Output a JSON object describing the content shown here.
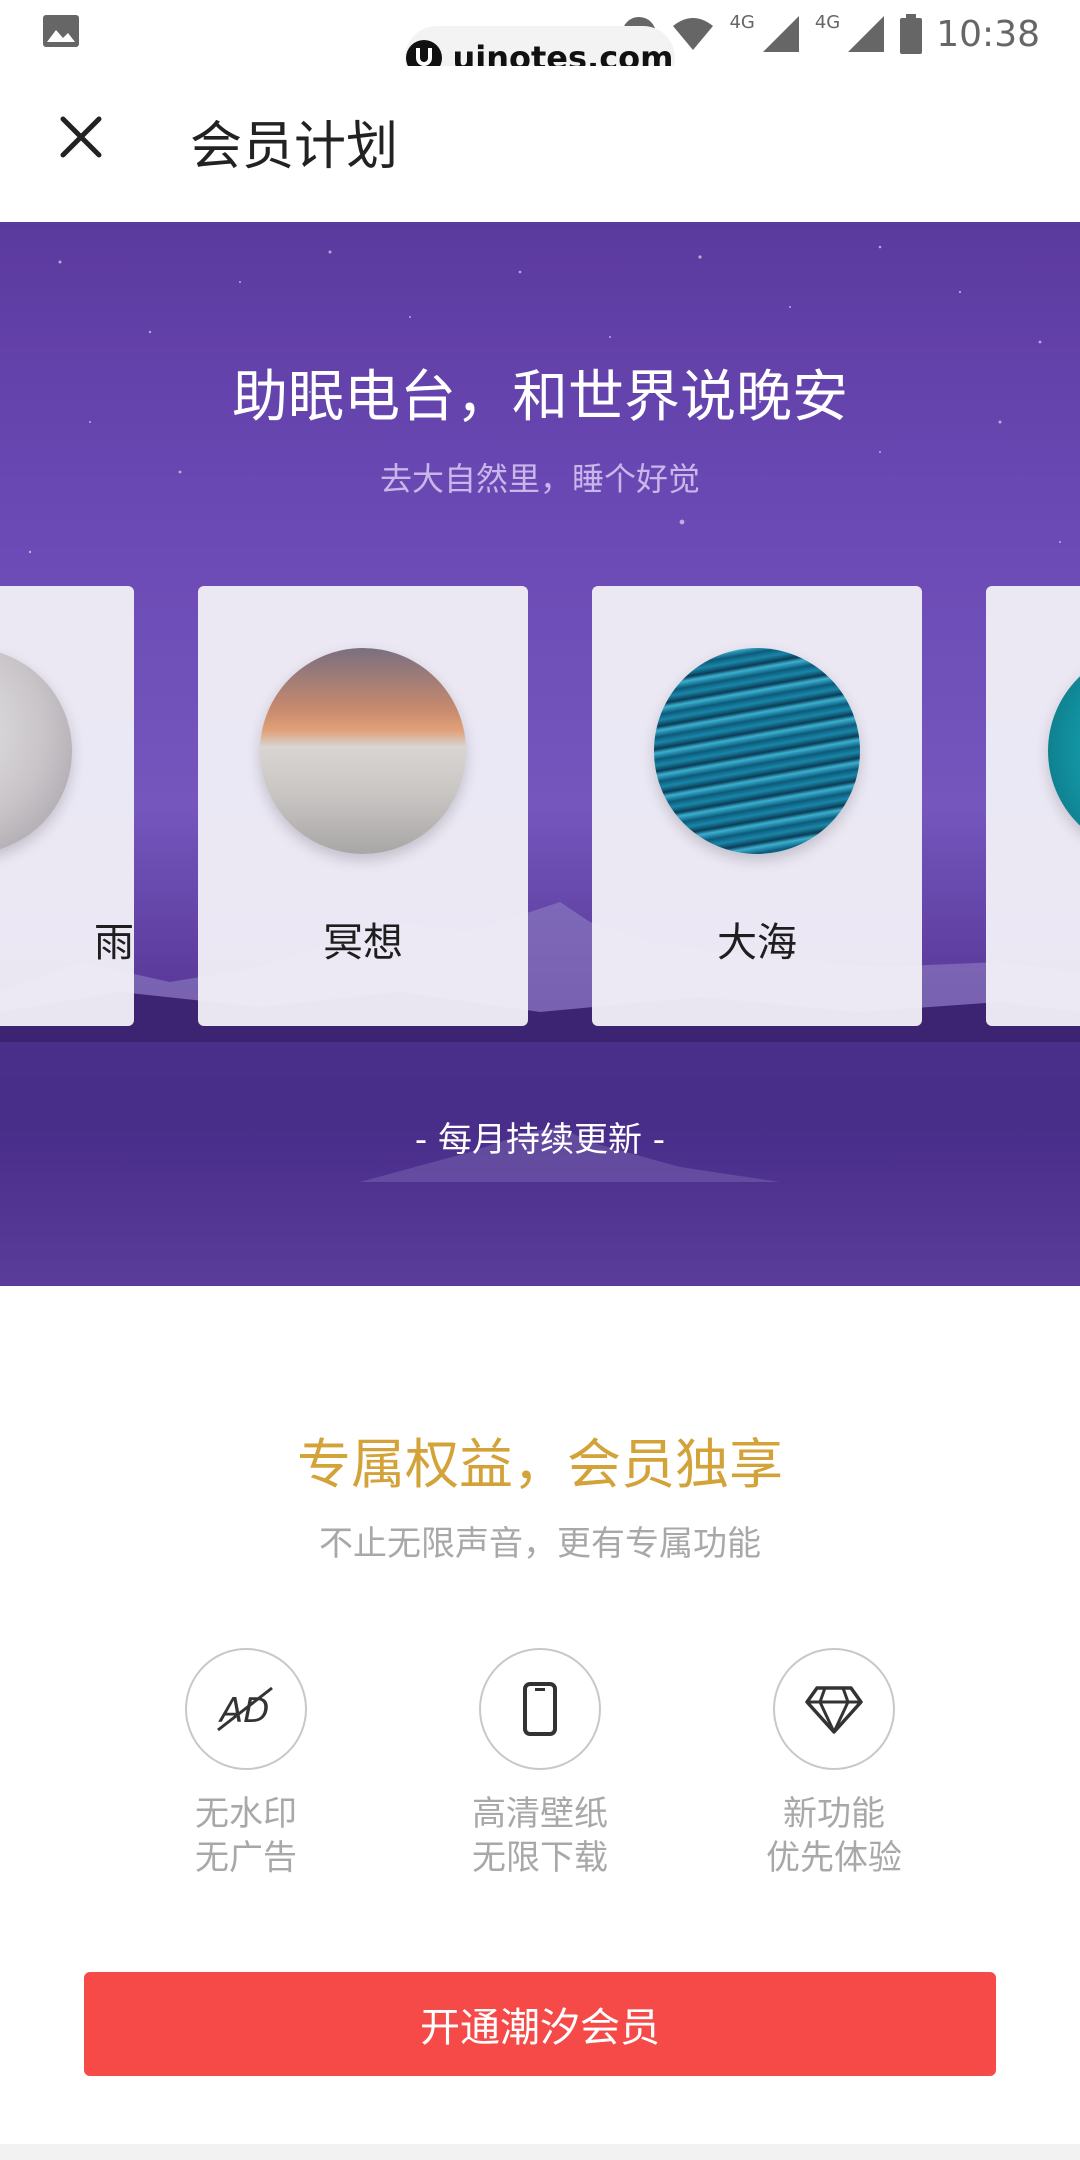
{
  "status_bar": {
    "time": "10:38",
    "network_1": "4G",
    "network_2": "4G",
    "icons": [
      "image-icon",
      "dnd-icon",
      "wifi-icon",
      "signal-icon",
      "signal-icon",
      "battery-icon"
    ]
  },
  "watermark": {
    "text": "uinotes.com"
  },
  "header": {
    "title": "会员计划",
    "close_icon": "close-icon"
  },
  "hero": {
    "title": "助眠电台，和世界说晚安",
    "subtitle": "去大自然里，睡个好觉",
    "cards": [
      {
        "label": "雨",
        "image": "snow-landscape"
      },
      {
        "label": "冥想",
        "image": "desert-dune"
      },
      {
        "label": "大海",
        "image": "ocean-waves"
      },
      {
        "label": "",
        "image": "teal-water"
      }
    ],
    "footer": "- 每月持续更新 -"
  },
  "benefits": {
    "title": "专属权益，会员独享",
    "subtitle": "不止无限声音，更有专属功能",
    "items": [
      {
        "icon": "no-ad-icon",
        "line1": "无水印",
        "line2": "无广告"
      },
      {
        "icon": "phone-icon",
        "line1": "高清壁纸",
        "line2": "无限下载"
      },
      {
        "icon": "diamond-icon",
        "line1": "新功能",
        "line2": "优先体验"
      }
    ]
  },
  "cta": {
    "label": "开通潮汐会员"
  },
  "colors": {
    "accent_gold": "#d3a33a",
    "cta_red": "#f64a48",
    "hero_purple": "#6a48b4"
  }
}
